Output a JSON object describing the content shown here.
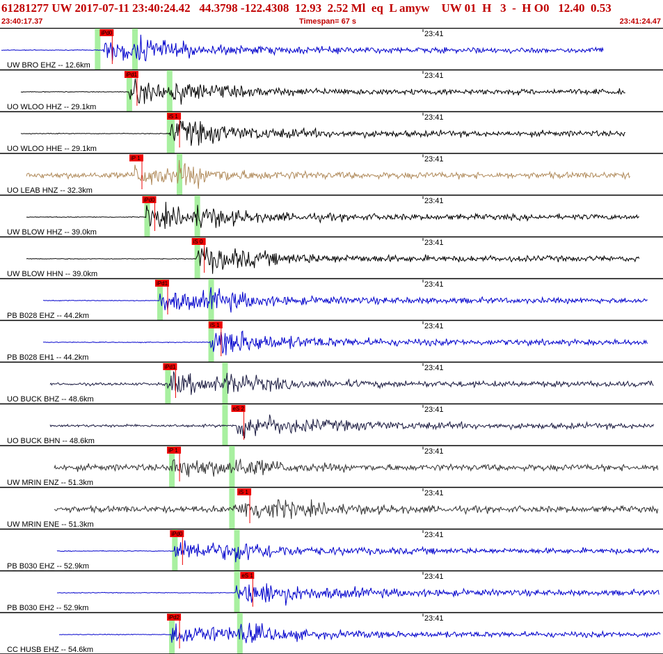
{
  "header": {
    "title": "61281277 UW 2017-07-11 23:40:24.42   44.3798 -122.4308  12.93  2.52 Ml  eq  L amyw    UW 01  H   3  -  H O0   12.40  0.53",
    "start_time": "23:40:17.37",
    "end_time": "23:41:24.47",
    "timespan": "Timespan=  67 s"
  },
  "chart_data": {
    "type": "line",
    "time_axis": {
      "start": "23:40:17.37",
      "end": "23:41:24.47",
      "span_s": 67,
      "tick_label": "23:41"
    },
    "colors": {
      "pick": "#ee0000",
      "window": "#a8f0a0",
      "separator": "#000000"
    },
    "traces": [
      {
        "label": "UW BRO EHZ -- 12.6km",
        "color": "#0000cc",
        "pick": "iPd0",
        "pick_t": 10.5,
        "s_t": 13.5
      },
      {
        "label": "UO WLOO HHZ -- 29.1km",
        "color": "#000000",
        "pick": "iPd1",
        "pick_t": 13.0,
        "s_t": 17.0
      },
      {
        "label": "UO WLOO HHE -- 29.1km",
        "color": "#000000",
        "pick": "iS 1",
        "pick_t": 17.3,
        "s_t": 17.0
      },
      {
        "label": "UO LEAB HNZ -- 32.3km",
        "color": "#b08a5a",
        "pick": "iP 1",
        "pick_t": 13.5,
        "s_t": 18.0
      },
      {
        "label": "UW BLOW HHZ -- 39.0km",
        "color": "#000000",
        "pick": "iPd0",
        "pick_t": 14.8,
        "s_t": 19.8
      },
      {
        "label": "UW BLOW HHN -- 39.0km",
        "color": "#000000",
        "pick": "iS 0",
        "pick_t": 19.8,
        "s_t": 19.8
      },
      {
        "label": "PB B028 EHZ -- 44.2km",
        "color": "#0000cc",
        "pick": "iPd1",
        "pick_t": 16.1,
        "s_t": 21.2
      },
      {
        "label": "PB B028 EH1 -- 44.2km",
        "color": "#0000cc",
        "pick": "iS 1",
        "pick_t": 21.5,
        "s_t": 21.2
      },
      {
        "label": "UO BUCK BHZ -- 48.6km",
        "color": "#1a1a40",
        "pick": "iPd1",
        "pick_t": 16.9,
        "s_t": 22.6
      },
      {
        "label": "UO BUCK BHN -- 48.6km",
        "color": "#1a1a40",
        "pick": "eS 2",
        "pick_t": 23.8,
        "s_t": 22.6
      },
      {
        "label": "UW MRIN ENZ -- 51.3km",
        "color": "#333333",
        "pick": "iP 1",
        "pick_t": 17.3,
        "s_t": 23.3
      },
      {
        "label": "UW MRIN ENE -- 51.3km",
        "color": "#333333",
        "pick": "iS 1",
        "pick_t": 24.4,
        "s_t": 23.3
      },
      {
        "label": "PB B030 EHZ -- 52.9km",
        "color": "#0000cc",
        "pick": "iPd0",
        "pick_t": 17.6,
        "s_t": 23.8
      },
      {
        "label": "PB B030 EH2 -- 52.9km",
        "color": "#0000cc",
        "pick": "eS 1",
        "pick_t": 24.7,
        "s_t": 23.8
      },
      {
        "label": "CC HUSB EHZ -- 54.6km",
        "color": "#0000cc",
        "pick": "iPd2",
        "pick_t": 17.3,
        "s_t": 24.1
      }
    ]
  }
}
